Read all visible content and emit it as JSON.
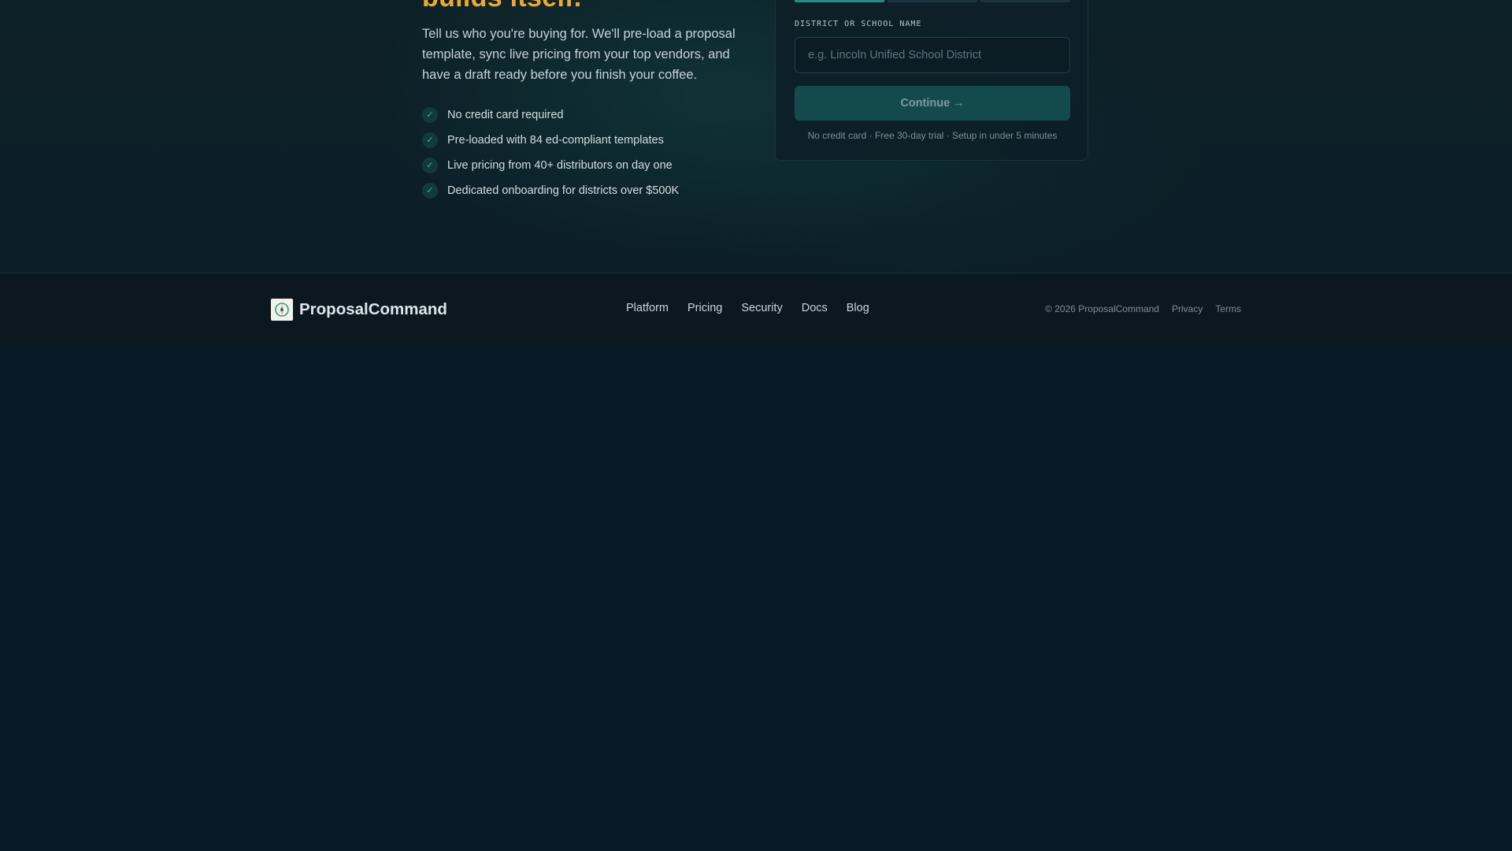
{
  "hero": {
    "headline": "builds itself.",
    "intro": "Tell us who you're buying for. We'll pre-load a proposal template, sync live pricing from your top vendors, and have a draft ready before you finish your coffee.",
    "benefits": [
      "No credit card required",
      "Pre-loaded with 84 ed-compliant templates",
      "Live pricing from 40+ distributors on day one",
      "Dedicated onboarding for districts over $500K"
    ],
    "check_glyph": "✓"
  },
  "signup": {
    "steps_total": 3,
    "step_active": 1,
    "field_label": "DISTRICT OR SCHOOL NAME",
    "placeholder": "e.g. Lincoln Unified School District",
    "value": "",
    "continue_label": "Continue →",
    "fine_print": "No credit card · Free 30-day trial · Setup in under 5 minutes"
  },
  "footer": {
    "brand": "ProposalCommand",
    "logo_icon": "compass-icon",
    "nav": [
      "Platform",
      "Pricing",
      "Security",
      "Docs",
      "Blog"
    ],
    "copyright": "© 2026 ProposalCommand",
    "privacy": "Privacy",
    "terms": "Terms"
  },
  "colors": {
    "accent_orange": "#f0a830",
    "accent_teal": "#1f8f86",
    "background": "#0a1926"
  }
}
